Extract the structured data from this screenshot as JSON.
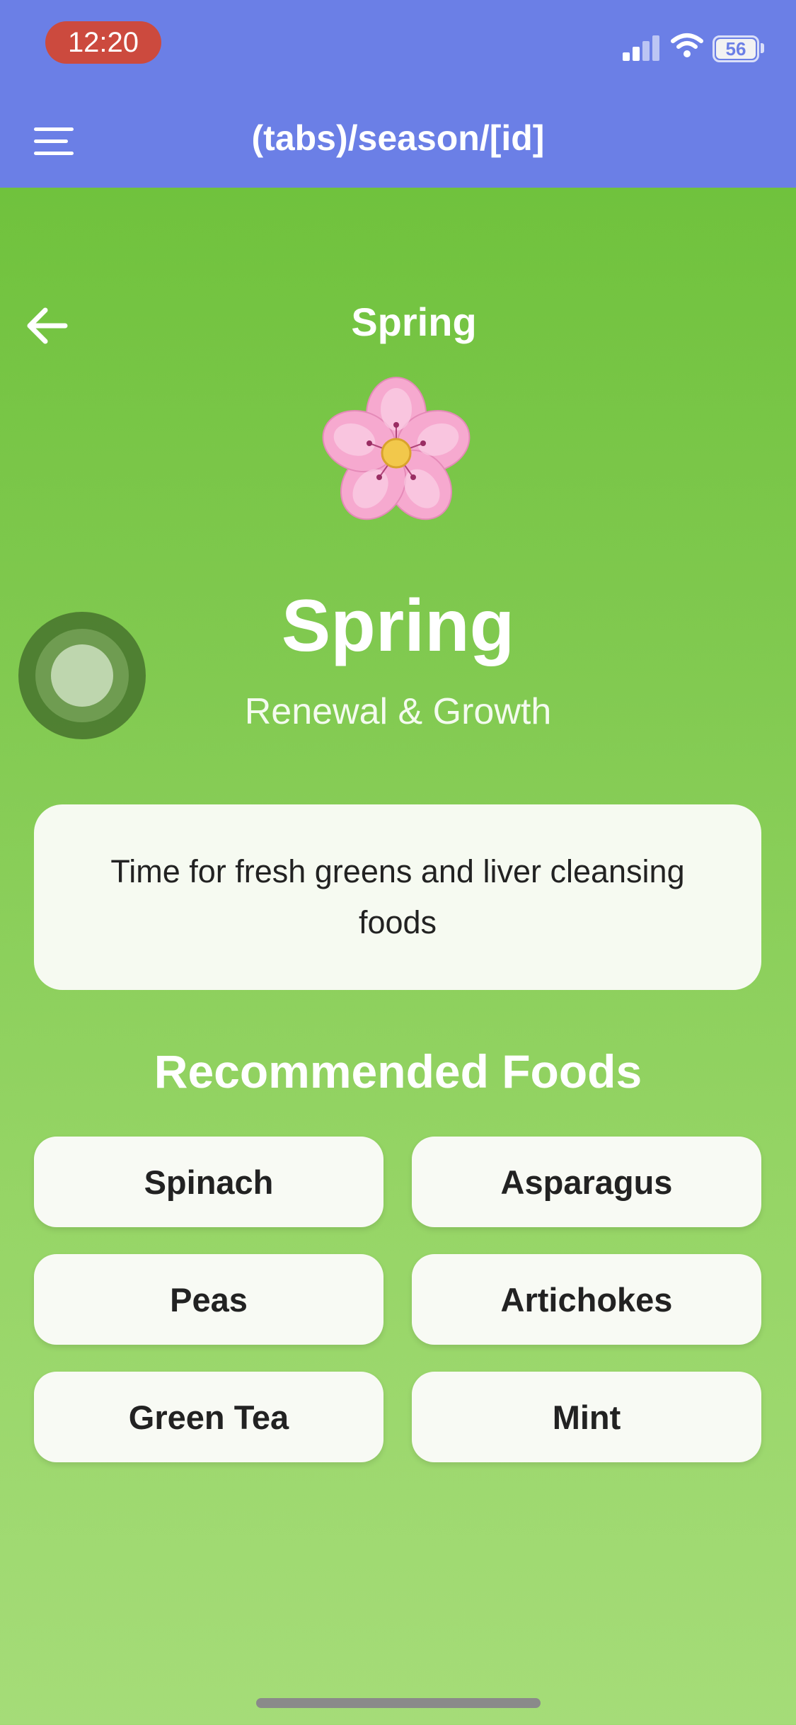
{
  "status_bar": {
    "time": "12:20",
    "battery_level": "56"
  },
  "nav": {
    "title": "(tabs)/season/[id]",
    "menu_icon": "hamburger-menu-icon"
  },
  "season": {
    "header": "Spring",
    "back_icon": "arrow-left-icon",
    "emoji": "cherry-blossom-icon",
    "title": "Spring",
    "subtitle": "Renewal & Growth",
    "description": "Time for fresh greens and liver cleansing foods"
  },
  "recommended": {
    "title": "Recommended Foods",
    "foods": [
      "Spinach",
      "Asparagus",
      "Peas",
      "Artichokes",
      "Green Tea",
      "Mint"
    ]
  },
  "colors": {
    "nav_background": "#6b7fe6",
    "screen_gradient_top": "#70c23d",
    "screen_gradient_bottom": "#a5dc78",
    "time_pill": "#cc4a3e",
    "card_background": "#f6faf1"
  }
}
